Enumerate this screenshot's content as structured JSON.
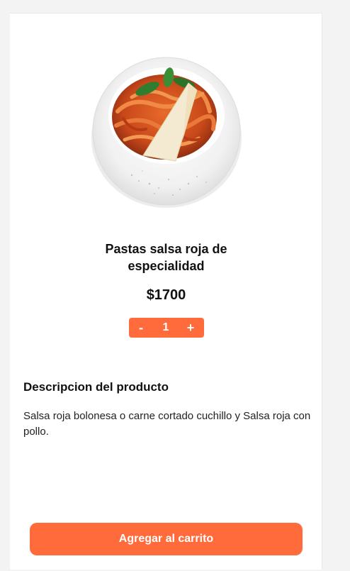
{
  "product": {
    "image_icon": "pasta-dish-image",
    "title_line1": "Pastas salsa roja de",
    "title_line2": "especialidad",
    "price": "$1700",
    "quantity": {
      "decrement_label": "-",
      "value": "1",
      "increment_label": "+"
    }
  },
  "description": {
    "heading": "Descripcion del producto",
    "text": "Salsa roja bolonesa o carne cortado cuchillo y Salsa roja con pollo."
  },
  "actions": {
    "add_to_cart_label": "Agregar al carrito"
  },
  "colors": {
    "accent": "#ff6b3a",
    "background": "#f3f3f3",
    "card": "#ffffff"
  }
}
